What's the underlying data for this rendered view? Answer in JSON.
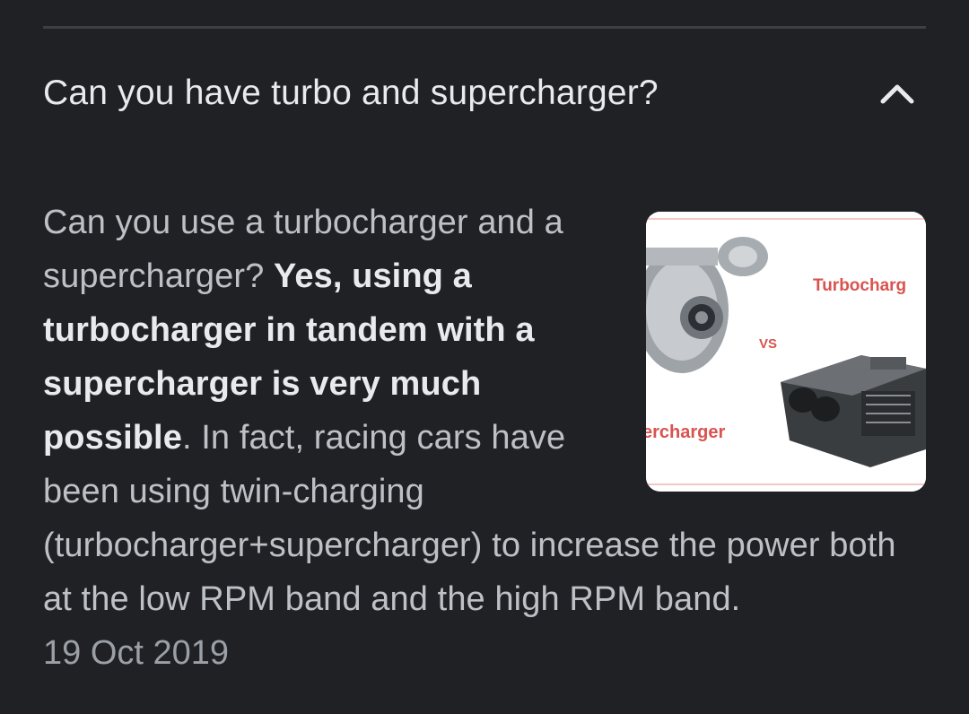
{
  "question": "Can you have turbo and supercharger?",
  "answer": {
    "intro": "Can you use a turbocharger and a supercharger? ",
    "highlight": "Yes, using a turbocharger in tandem with a supercharger is very much possible",
    "rest": ". In fact, racing cars have been using twin-charging (turbocharger+supercharger) to increase the power both at the low RPM band and the high RPM band.",
    "date": "19 Oct 2019"
  },
  "thumbnail": {
    "label_turbo": "Turbocharg",
    "label_vs": "VS",
    "label_super": "ercharger"
  },
  "icons": {
    "collapse": "chevron-up-icon"
  },
  "colors": {
    "background": "#202124",
    "text_primary": "#e8eaed",
    "text_secondary": "#bdc1c6",
    "text_muted": "#9aa0a6",
    "divider": "#3c4043",
    "thumb_label": "#d9534f"
  }
}
